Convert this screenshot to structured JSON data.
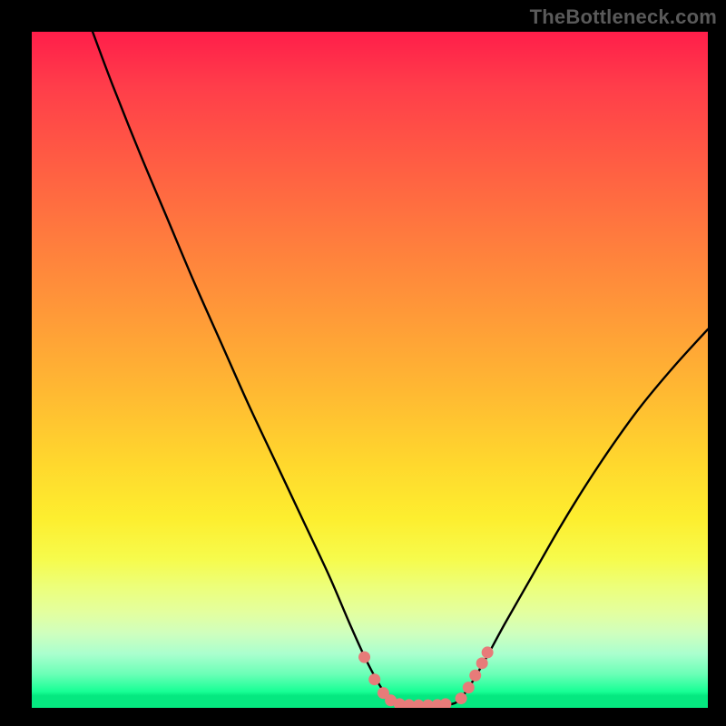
{
  "watermark": "TheBottleneck.com",
  "colors": {
    "frame": "#000000",
    "curve": "#000000",
    "marker": "#e77b79",
    "gradient_top": "#ff1e4a",
    "gradient_bottom": "#05e880"
  },
  "chart_data": {
    "type": "line",
    "title": "",
    "xlabel": "",
    "ylabel": "",
    "xlim": [
      0,
      100
    ],
    "ylim": [
      0,
      100
    ],
    "grid": false,
    "series": [
      {
        "name": "left-curve",
        "x": [
          9,
          12,
          16,
          20,
          24,
          28,
          32,
          36,
          40,
          44,
          47,
          49.5,
          51.8,
          53.5
        ],
        "y": [
          100,
          92,
          82,
          72.5,
          63,
          54,
          45,
          36.5,
          28,
          19.5,
          12.5,
          7,
          2.8,
          0.8
        ]
      },
      {
        "name": "valley-floor",
        "x": [
          53.5,
          55,
          57,
          59,
          61,
          62.8
        ],
        "y": [
          0.8,
          0.5,
          0.4,
          0.4,
          0.5,
          0.8
        ]
      },
      {
        "name": "right-curve",
        "x": [
          62.8,
          64.5,
          67,
          70,
          74,
          78,
          82,
          86,
          90,
          95,
          100
        ],
        "y": [
          0.8,
          2.8,
          7,
          12.5,
          19.5,
          26.5,
          33,
          39,
          44.5,
          50.5,
          56
        ]
      }
    ],
    "markers": [
      {
        "series": "left-markers",
        "x": 49.2,
        "y": 7.5
      },
      {
        "series": "left-markers",
        "x": 50.7,
        "y": 4.2
      },
      {
        "series": "left-markers",
        "x": 52.0,
        "y": 2.2
      },
      {
        "series": "left-markers",
        "x": 53.1,
        "y": 1.1
      },
      {
        "series": "floor-markers",
        "x": 54.4,
        "y": 0.55
      },
      {
        "series": "floor-markers",
        "x": 55.8,
        "y": 0.42
      },
      {
        "series": "floor-markers",
        "x": 57.2,
        "y": 0.38
      },
      {
        "series": "floor-markers",
        "x": 58.6,
        "y": 0.38
      },
      {
        "series": "floor-markers",
        "x": 60.0,
        "y": 0.42
      },
      {
        "series": "floor-markers",
        "x": 61.2,
        "y": 0.55
      },
      {
        "series": "right-markers",
        "x": 63.5,
        "y": 1.4
      },
      {
        "series": "right-markers",
        "x": 64.6,
        "y": 3.0
      },
      {
        "series": "right-markers",
        "x": 65.6,
        "y": 4.8
      },
      {
        "series": "right-markers",
        "x": 66.6,
        "y": 6.6
      },
      {
        "series": "right-markers",
        "x": 67.4,
        "y": 8.2
      }
    ]
  }
}
